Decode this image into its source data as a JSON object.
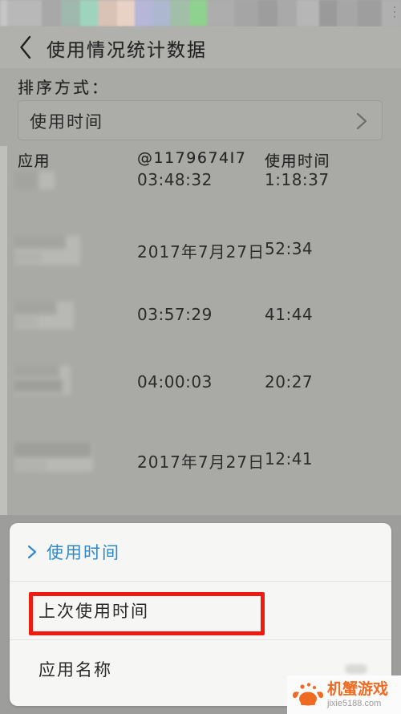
{
  "nav": {
    "back_icon": "chevron-left-icon",
    "title": "使用情况统计数据"
  },
  "sort": {
    "label": "排序方式：",
    "selected_value": "使用时间",
    "chevron_icon": "chevron-right-icon"
  },
  "table": {
    "headers": {
      "app": "应用",
      "last_used": "@1179674I7",
      "duration": "使用时间"
    },
    "rows": [
      {
        "app": "",
        "last_used": "03:48:32",
        "duration": "1:18:37"
      },
      {
        "app": "",
        "last_used": "2017年7月27日",
        "duration": "52:34"
      },
      {
        "app": "",
        "last_used": "03:57:29",
        "duration": "41:44"
      },
      {
        "app": "",
        "last_used": "04:00:03",
        "duration": "20:27"
      },
      {
        "app": "",
        "last_used": "2017年7月27日",
        "duration": "12:41"
      }
    ]
  },
  "sheet": {
    "options": [
      {
        "label": "使用时间",
        "selected": true
      },
      {
        "label": "上次使用时间",
        "selected": false
      },
      {
        "label": "应用名称",
        "selected": false
      }
    ],
    "selected_chevron_icon": "chevron-right-icon",
    "highlight_color": "#ee1b11",
    "selected_color": "#2f88c8"
  },
  "watermark": {
    "logo_icon": "crab-logo-icon",
    "title": "机蟹游戏",
    "url": "jixie5188.com"
  }
}
